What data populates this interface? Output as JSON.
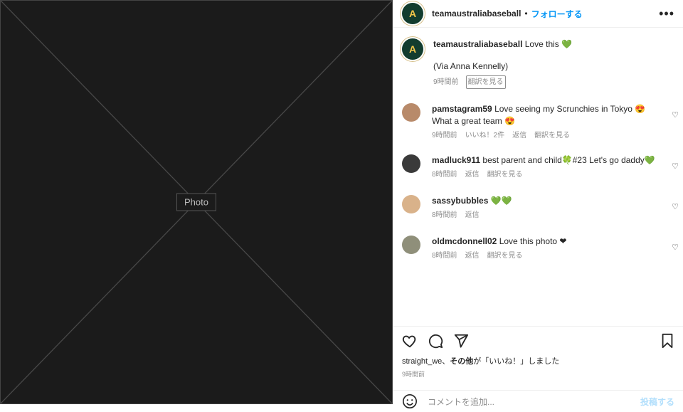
{
  "photo": {
    "caption": "Photo"
  },
  "header": {
    "username": "teamaustraliabaseball",
    "separator": "•",
    "follow_label": "フォローする",
    "more": "•••",
    "avatar_letter": "A"
  },
  "caption": {
    "username": "teamaustraliabaseball",
    "text": "Love this 💚",
    "via": "(Via Anna Kennelly)",
    "time": "9時間前",
    "translate": "翻訳を見る"
  },
  "comments": [
    {
      "username": "pamstagram59",
      "text": "Love seeing my Scrunchies in Tokyo 😍 What a great team 😍",
      "time": "9時間前",
      "likes": "いいね！2件",
      "reply": "返信",
      "translate": "翻訳を見る",
      "avatar_color": "#b88a6a"
    },
    {
      "username": "madluck911",
      "text": "best parent and child🍀#23 Let's go daddy💚",
      "time": "8時間前",
      "likes": "",
      "reply": "返信",
      "translate": "翻訳を見る",
      "avatar_color": "#3a3a3a"
    },
    {
      "username": "sassybubbles",
      "text": "💚💚",
      "time": "8時間前",
      "likes": "",
      "reply": "返信",
      "translate": "",
      "avatar_color": "#d9b28a"
    },
    {
      "username": "oldmcdonnell02",
      "text": "Love this photo ❤",
      "time": "8時間前",
      "likes": "",
      "reply": "返信",
      "translate": "翻訳を見る",
      "avatar_color": "#8f8f7a"
    }
  ],
  "likes": {
    "user": "straight_we",
    "sep": "、",
    "others": "その他",
    "suffix": "が「いいね！」しました"
  },
  "posted_time": "9時間前",
  "add_comment": {
    "placeholder": "コメントを追加...",
    "post_label": "投稿する"
  },
  "colors": {
    "accent": "#0095f6",
    "brand_green": "#123c2e",
    "brand_gold": "#f3c64a"
  }
}
